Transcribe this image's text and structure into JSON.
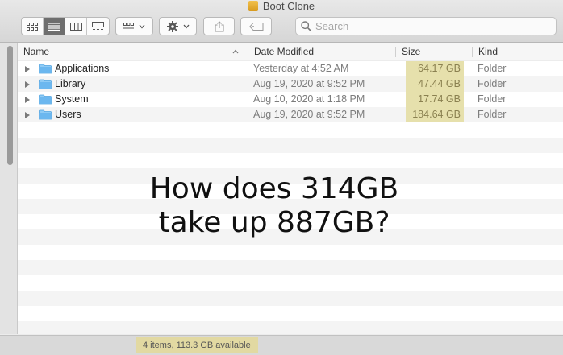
{
  "window": {
    "title": "Boot Clone"
  },
  "toolbar": {
    "view_modes": [
      {
        "name": "view-icons-button",
        "icon": "grid-icon"
      },
      {
        "name": "view-list-button",
        "icon": "list-icon",
        "active": true
      },
      {
        "name": "view-columns-button",
        "icon": "columns-icon"
      },
      {
        "name": "view-gallery-button",
        "icon": "gallery-icon"
      }
    ],
    "group_icon": "group-grid-icon",
    "action_icon": "gear-icon",
    "share_icon": "share-icon",
    "tag_icon": "tag-icon"
  },
  "search": {
    "placeholder": "Search"
  },
  "columns": {
    "name": "Name",
    "date": "Date Modified",
    "size": "Size",
    "kind": "Kind"
  },
  "rows": [
    {
      "name": "Applications",
      "date": "Yesterday at 4:52 AM",
      "size": "64.17 GB",
      "kind": "Folder"
    },
    {
      "name": "Library",
      "date": "Aug 19, 2020 at 9:52 PM",
      "size": "47.44 GB",
      "kind": "Folder"
    },
    {
      "name": "System",
      "date": "Aug 10, 2020 at 1:18 PM",
      "size": "17.74 GB",
      "kind": "Folder"
    },
    {
      "name": "Users",
      "date": "Aug 19, 2020 at 9:52 PM",
      "size": "184.64 GB",
      "kind": "Folder"
    }
  ],
  "caption": {
    "line1": "How does 314GB",
    "line2": "take up 887GB?"
  },
  "status": {
    "text": "4 items, 113.3 GB available"
  },
  "colors": {
    "highlight": "#e6e0ac",
    "folder": "#6bb7ef",
    "active_segment": "#6e6e6e"
  }
}
